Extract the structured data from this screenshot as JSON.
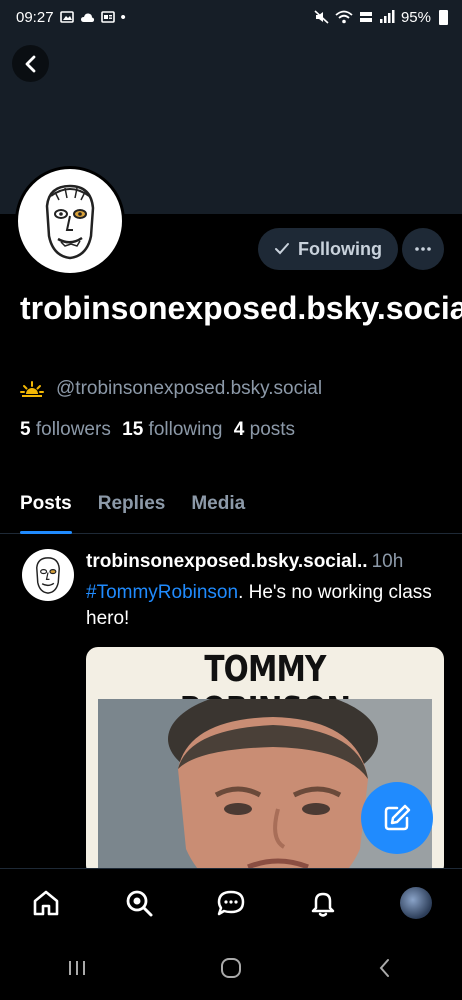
{
  "status_bar": {
    "time": "09:27",
    "battery": "95%",
    "dot": "•"
  },
  "profile": {
    "display_name": "trobinsonexposed.bsky.social",
    "handle": "@trobinsonexposed.bsky.social",
    "following_label": "Following",
    "stats": {
      "followers_count": "5",
      "followers_label": "followers",
      "following_count": "15",
      "following_label": "following",
      "posts_count": "4",
      "posts_label": "posts"
    }
  },
  "tabs": [
    {
      "label": "Posts",
      "active": true
    },
    {
      "label": "Replies",
      "active": false
    },
    {
      "label": "Media",
      "active": false
    }
  ],
  "post": {
    "author": "trobinsonexposed.bsky.social..",
    "time": "10h",
    "hashtag": "#TommyRobinson",
    "text": ". He's no working class hero!",
    "image_title": "TOMMY ROBINSON"
  },
  "icons": {
    "back": "chevron-left-icon",
    "more": "ellipsis-icon",
    "compose": "pencil-icon",
    "nav": [
      "home-icon",
      "search-icon",
      "chat-icon",
      "bell-icon",
      "profile-avatar"
    ],
    "system_nav": [
      "recents-icon",
      "home-circle-icon",
      "back-icon"
    ]
  },
  "colors": {
    "accent": "#208bfe",
    "banner": "#161e27",
    "background": "#000000",
    "muted": "#8c99a8"
  }
}
